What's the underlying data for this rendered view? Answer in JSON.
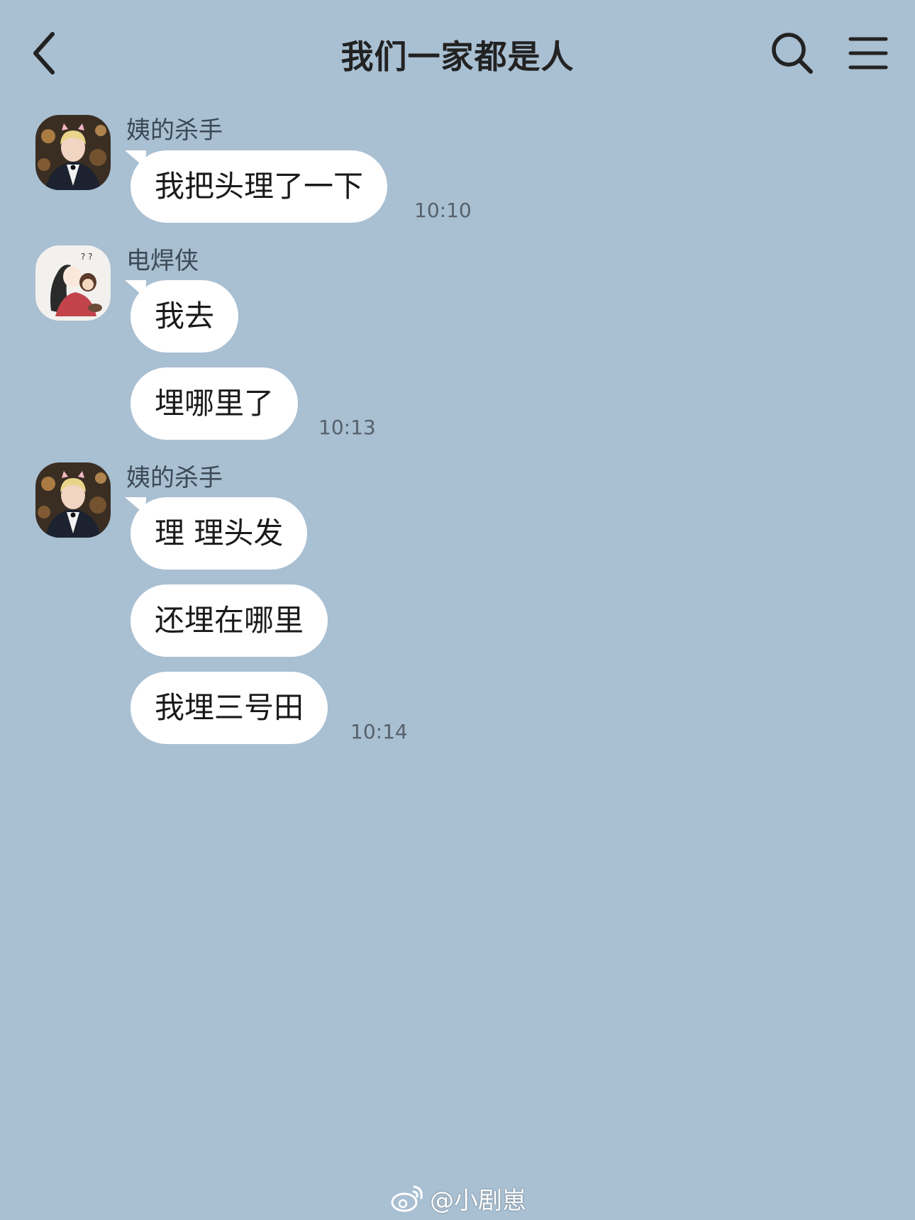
{
  "header": {
    "title": "我们一家都是人",
    "back_icon": "chevron-left-icon",
    "search_icon": "search-icon",
    "menu_icon": "hamburger-menu-icon"
  },
  "messages": [
    {
      "sender": "姨的杀手",
      "bubbles": [
        "我把头理了一下"
      ],
      "time": "10:10"
    },
    {
      "sender": "电焊侠",
      "bubbles": [
        "我去",
        "埋哪里了"
      ],
      "time": "10:13"
    },
    {
      "sender": "姨的杀手",
      "bubbles": [
        "理 理头发",
        "还埋在哪里",
        "我埋三号田"
      ],
      "time": "10:14"
    }
  ],
  "watermark": {
    "text": "@小剧崽",
    "icon": "weibo-logo-icon"
  },
  "colors": {
    "background": "#a9bfd2",
    "bubble": "#ffffff",
    "text": "#1a1a1a"
  }
}
